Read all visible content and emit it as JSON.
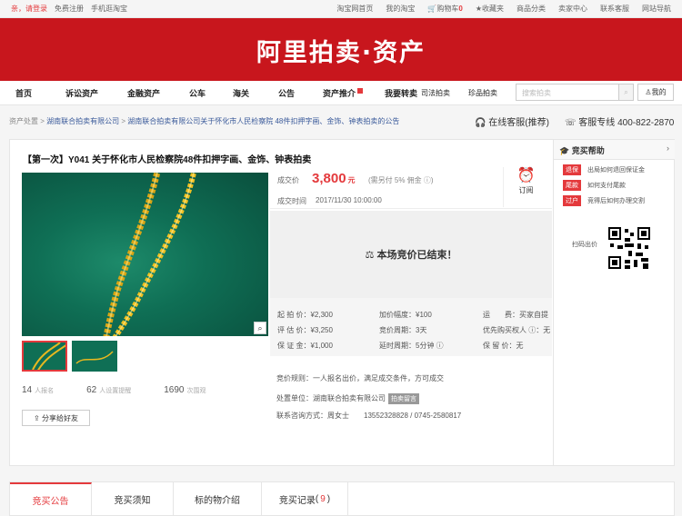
{
  "topbar": {
    "greeting": "亲，请登录",
    "register": "免费注册",
    "mobile": "手机逛淘宝",
    "links": [
      "淘宝网首页",
      "我的淘宝",
      "购物车",
      "收藏夹",
      "商品分类",
      "卖家中心",
      "联系客服",
      "网站导航"
    ],
    "cart_count": "0"
  },
  "banner": {
    "logo": "阿里拍卖·资产"
  },
  "nav": {
    "items": [
      "首页",
      "诉讼资产",
      "金融资产",
      "公车",
      "海关",
      "公告",
      "资产推介",
      "我要转卖"
    ],
    "small_items": [
      "司法拍卖",
      "珍品拍卖"
    ],
    "search_placeholder": "搜索拍卖",
    "mine": "我的"
  },
  "breadcrumb": {
    "root": "资产处置",
    "company": "湖南联合拍卖有限公司",
    "current": "湖南联合拍卖有限公司关于怀化市人民检察院 48件扣押字画、金饰、钟表拍卖的公告"
  },
  "service": {
    "online": "在线客服(推荐)",
    "hotline": "客服专线 400-822-2870"
  },
  "item": {
    "title": "【第一次】Y041 关于怀化市人民检察院48件扣押字画、金饰、钟表拍卖",
    "deal_price_label": "成交价",
    "deal_price": "3,800",
    "currency": "元",
    "fee_note": "(需另付 5% 佣金 ⓘ)",
    "deal_time_label": "成交时间",
    "deal_time": "2017/11/30 10:00:00",
    "remind": "订阅",
    "ended_text": "本场竞价已结束！",
    "info": [
      [
        "起 拍 价：¥2,300",
        "加价幅度：¥100",
        "运　　费：买家自提"
      ],
      [
        "评 估 价：¥3,250",
        "竞价周期：3天",
        "优先购买权人 ⓘ：无"
      ],
      [
        "保 证 金：¥1,000",
        "延时周期：5分钟 ⓘ",
        "保 留 价：无"
      ]
    ],
    "rule": "竞价规则：一人报名出价，满足成交条件，方可成交",
    "unit_label": "处置单位：",
    "unit": "湖南联合拍卖有限公司",
    "unit_tag": "拍卖留言",
    "contact": "联系咨询方式：周女士　　13552328828 / 0745-2580817"
  },
  "stats": [
    {
      "num": "14",
      "label": "人报名"
    },
    {
      "num": "62",
      "label": "人设置提醒"
    },
    {
      "num": "1690",
      "label": "次围观"
    }
  ],
  "share": "分享给好友",
  "help": {
    "title": "竞买帮助",
    "rows": [
      {
        "tag": "退保",
        "text": "出局如何退回保证金"
      },
      {
        "tag": "尾款",
        "text": "如何支付尾款"
      },
      {
        "tag": "过户",
        "text": "竞得后如何办理交割"
      }
    ],
    "qr_label": "扫码出价"
  },
  "tabs": [
    {
      "label": "竞买公告"
    },
    {
      "label": "竞买须知"
    },
    {
      "label": "标的物介绍"
    },
    {
      "label": "竞买记录",
      "count": "9"
    }
  ],
  "colors": {
    "brand": "#c8161d",
    "accent": "#e4393c"
  }
}
